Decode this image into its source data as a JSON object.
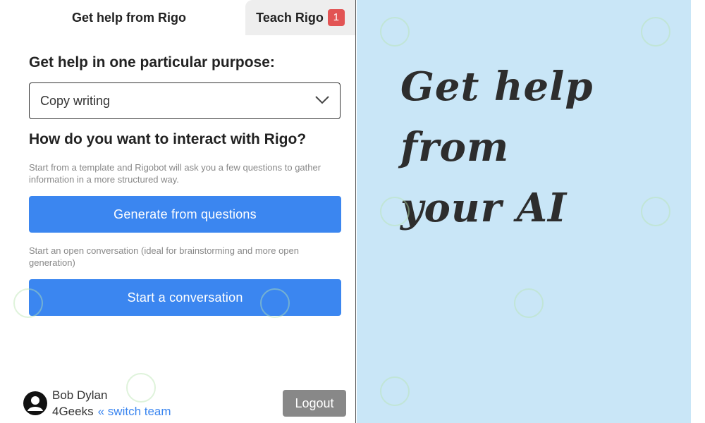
{
  "tabs": {
    "active_label": "Get help from Rigo",
    "inactive_label": "Teach Rigo",
    "inactive_badge": "1"
  },
  "purpose": {
    "heading": "Get help in one particular purpose:",
    "selected": "Copy writing"
  },
  "interact": {
    "heading": "How do you want to interact with Rigo?",
    "template_hint": "Start from a template and Rigobot will ask you a few questions to gather information in a more structured way.",
    "generate_label": "Generate from questions",
    "conversation_hint": "Start an open conversation (ideal for brainstorming and more open generation)",
    "conversation_label": "Start a conversation"
  },
  "user": {
    "name": "Bob Dylan",
    "team": "4Geeks",
    "switch_team": "switch team",
    "logout_label": "Logout"
  },
  "hero": {
    "line1": "Get help from",
    "line2": "your AI"
  },
  "colors": {
    "primary": "#3b86f0",
    "badge": "#e25454",
    "right_bg": "#c9e6f7",
    "logout_bg": "#888888"
  }
}
